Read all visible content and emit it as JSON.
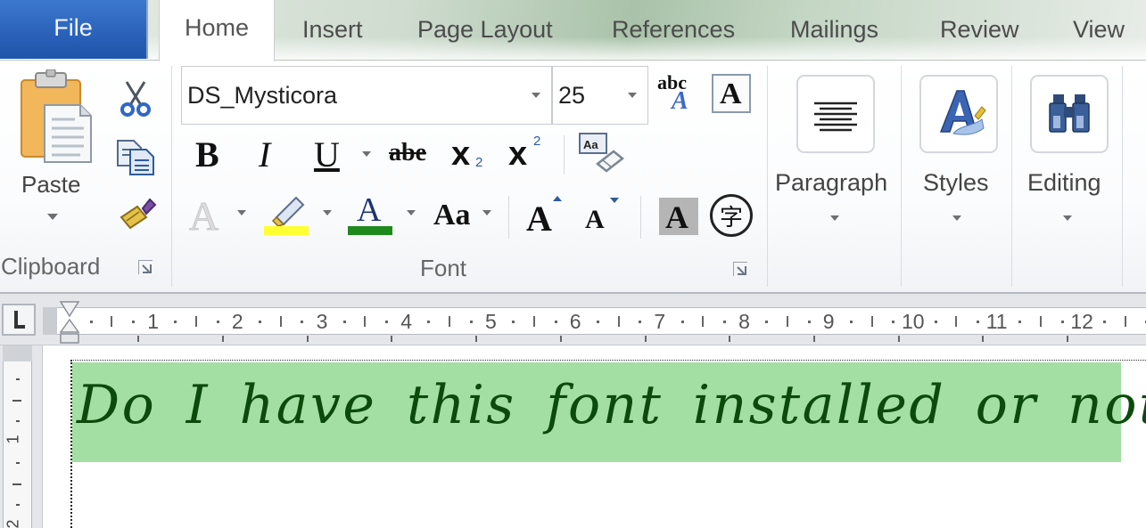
{
  "tabs": {
    "file": "File",
    "home": "Home",
    "insert": "Insert",
    "page_layout": "Page Layout",
    "references": "References",
    "mailings": "Mailings",
    "review": "Review",
    "view": "View"
  },
  "clipboard": {
    "paste_label": "Paste",
    "group_label": "Clipboard",
    "icons": [
      "paste-icon",
      "cut-icon",
      "copy-icon",
      "format-painter-icon"
    ]
  },
  "font": {
    "font_name": "DS_Mysticora",
    "font_size": "25",
    "group_label": "Font",
    "bold_glyph": "B",
    "italic_glyph": "I",
    "underline_glyph": "U",
    "strikethrough_glyph": "abe",
    "subscript_glyph": "x",
    "subscript_index": "2",
    "superscript_glyph": "x",
    "superscript_index": "2",
    "change_styles_glyph_top": "abc",
    "change_styles_glyph_bottom": "A",
    "character_border_glyph": "A",
    "clear_formatting_glyph": "Aa",
    "text_effects_glyph": "A",
    "font_color_glyph": "A",
    "change_case_glyph": "Aa",
    "grow_font_glyph": "A",
    "shrink_font_glyph": "A",
    "character_shading_glyph": "A",
    "enclose_characters_glyph": "字",
    "highlight_color": "#ffff33",
    "font_color": "#1e8a1e"
  },
  "paragraph": {
    "label": "Paragraph"
  },
  "styles": {
    "label": "Styles"
  },
  "editing": {
    "label": "Editing"
  },
  "ruler": {
    "numbers": [
      "1",
      "2",
      "3",
      "4",
      "5",
      "6",
      "7",
      "8",
      "9",
      "10",
      "11",
      "12"
    ],
    "vertical_numbers": [
      "1",
      "2"
    ]
  },
  "document": {
    "text": "Do I have this font installed or not?",
    "highlight_color": "#a3dea3",
    "text_color": "#0c4a0c"
  }
}
